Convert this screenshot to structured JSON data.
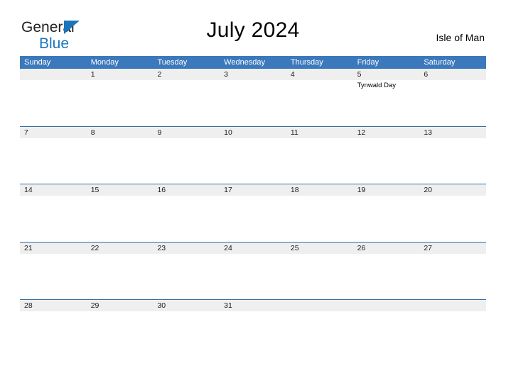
{
  "brand": {
    "line1": "General",
    "line2": "Blue",
    "triangle_color": "#1b74bb",
    "text_color": "#231f20"
  },
  "header": {
    "title": "July 2024",
    "region": "Isle of Man"
  },
  "colors": {
    "header_blue": "#3b78bc",
    "row_divider_blue": "#2e6da4",
    "daynum_band_gray": "#efefef",
    "text_dark": "#1a1a1a",
    "page_background": "#ffffff"
  },
  "weekdays": [
    "Sunday",
    "Monday",
    "Tuesday",
    "Wednesday",
    "Thursday",
    "Friday",
    "Saturday"
  ],
  "weeks": [
    {
      "days": [
        {
          "num": "",
          "event": ""
        },
        {
          "num": "1",
          "event": ""
        },
        {
          "num": "2",
          "event": ""
        },
        {
          "num": "3",
          "event": ""
        },
        {
          "num": "4",
          "event": ""
        },
        {
          "num": "5",
          "event": "Tynwald Day"
        },
        {
          "num": "6",
          "event": ""
        }
      ]
    },
    {
      "days": [
        {
          "num": "7",
          "event": ""
        },
        {
          "num": "8",
          "event": ""
        },
        {
          "num": "9",
          "event": ""
        },
        {
          "num": "10",
          "event": ""
        },
        {
          "num": "11",
          "event": ""
        },
        {
          "num": "12",
          "event": ""
        },
        {
          "num": "13",
          "event": ""
        }
      ]
    },
    {
      "days": [
        {
          "num": "14",
          "event": ""
        },
        {
          "num": "15",
          "event": ""
        },
        {
          "num": "16",
          "event": ""
        },
        {
          "num": "17",
          "event": ""
        },
        {
          "num": "18",
          "event": ""
        },
        {
          "num": "19",
          "event": ""
        },
        {
          "num": "20",
          "event": ""
        }
      ]
    },
    {
      "days": [
        {
          "num": "21",
          "event": ""
        },
        {
          "num": "22",
          "event": ""
        },
        {
          "num": "23",
          "event": ""
        },
        {
          "num": "24",
          "event": ""
        },
        {
          "num": "25",
          "event": ""
        },
        {
          "num": "26",
          "event": ""
        },
        {
          "num": "27",
          "event": ""
        }
      ]
    },
    {
      "days": [
        {
          "num": "28",
          "event": ""
        },
        {
          "num": "29",
          "event": ""
        },
        {
          "num": "30",
          "event": ""
        },
        {
          "num": "31",
          "event": ""
        },
        {
          "num": "",
          "event": ""
        },
        {
          "num": "",
          "event": ""
        },
        {
          "num": "",
          "event": ""
        }
      ]
    }
  ]
}
